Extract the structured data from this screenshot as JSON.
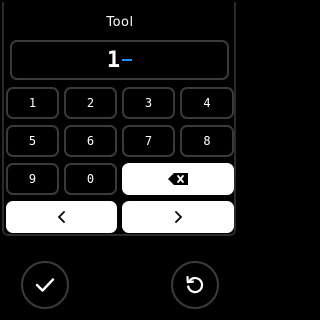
{
  "dialog": {
    "title": "Tool"
  },
  "display": {
    "value": "1"
  },
  "keypad": {
    "keys": [
      "1",
      "2",
      "3",
      "4",
      "5",
      "6",
      "7",
      "8",
      "9",
      "0"
    ]
  },
  "icons": {
    "backspace": "backspace-icon",
    "left": "chevron-left-icon",
    "right": "chevron-right-icon",
    "confirm": "checkmark-icon",
    "reset": "reset-icon"
  },
  "colors": {
    "background": "#000000",
    "border": "#3a3a3a",
    "cursor": "#1e90ff",
    "light_button": "#ffffff"
  }
}
